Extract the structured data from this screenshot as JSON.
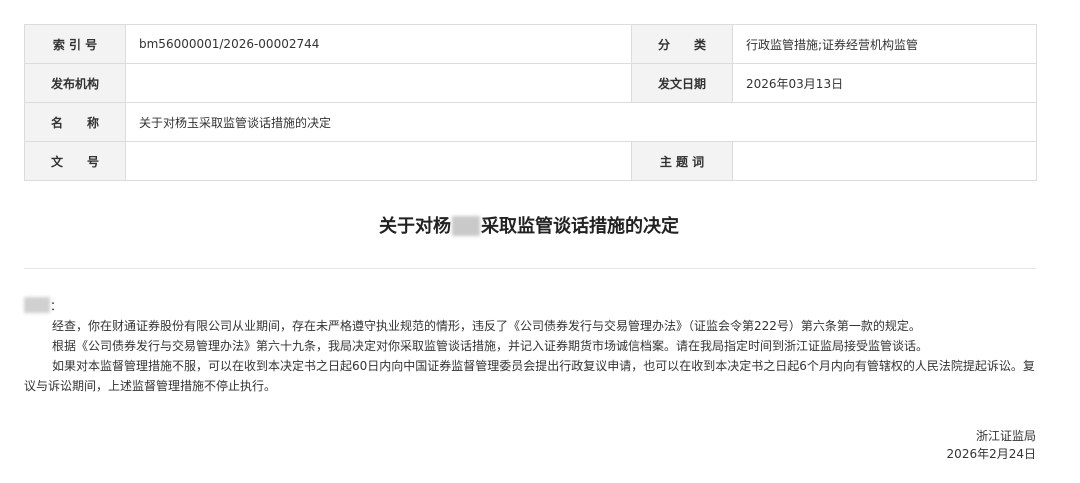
{
  "meta": {
    "index_no_label": "索 引 号",
    "index_no_value": "bm56000001/2026-00002744",
    "category_label": "分　　类",
    "category_value": "行政监管措施;证券经营机构监管",
    "issuer_label": "发布机构",
    "issuer_value": "",
    "issue_date_label": "发文日期",
    "issue_date_value": "2026年03月13日",
    "name_label": "名　　称",
    "name_value": "关于对杨玉采取监管谈话措施的决定",
    "doc_no_label": "文　　号",
    "doc_no_value": "",
    "keywords_label": "主 题 词",
    "keywords_value": ""
  },
  "document": {
    "title_before": "关于对杨",
    "title_after": "采取监管谈话措施的决定",
    "salutation_suffix": "：",
    "paragraph_1": "经查，你在财通证券股份有限公司从业期间，存在未严格遵守执业规范的情形，违反了《公司债券发行与交易管理办法》（证监会令第222号）第六条第一款的规定。",
    "paragraph_2": "根据《公司债券发行与交易管理办法》第六十九条，我局决定对你采取监管谈话措施，并记入证券期货市场诚信档案。请在我局指定时间到浙江证监局接受监管谈话。",
    "paragraph_3": "如果对本监督管理措施不服，可以在收到本决定书之日起60日内向中国证券监督管理委员会提出行政复议申请，也可以在收到本决定书之日起6个月内向有管辖权的人民法院提起诉讼。复议与诉讼期间，上述监督管理措施不停止执行。",
    "signer": "浙江证监局",
    "sign_date": "2026年2月24日"
  }
}
